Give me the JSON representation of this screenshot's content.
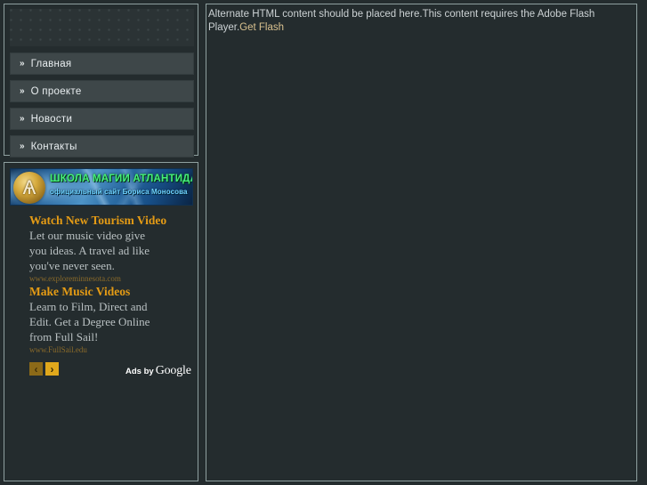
{
  "sidebar": {
    "nav": {
      "marker": "»",
      "items": [
        {
          "label": "Главная"
        },
        {
          "label": "О проекте"
        },
        {
          "label": "Новости"
        },
        {
          "label": "Контакты"
        }
      ]
    },
    "banner": {
      "title": "ШКОЛА МАГИИ АТЛАНТИДА",
      "subtitle": "официальный сайт Бориса Моносова",
      "emblem_glyph": "Ѧ",
      "title_color": "#45f07a",
      "subtitle_color": "#6fd3ff"
    },
    "ads": {
      "items": [
        {
          "title": "Watch New Tourism Video",
          "lines": [
            "Let our music video give",
            "you ideas. A travel ad like",
            "you've never seen."
          ],
          "url": "www.exploreminnesota.com"
        },
        {
          "title": "Make Music Videos",
          "lines": [
            "Learn to Film, Direct and",
            "Edit. Get a Degree Online",
            "from Full Sail!"
          ],
          "url": "www.FullSail.edu"
        }
      ],
      "prev_glyph": "‹",
      "next_glyph": "›",
      "attribution_prefix": "Ads by",
      "attribution_brand": "Google",
      "title_color": "#e49b15",
      "url_color": "#8a6a2a"
    }
  },
  "content": {
    "fallback_text": "Alternate HTML content should be placed here.This content requires the Adobe Flash Player.",
    "fallback_link": "Get Flash",
    "link_color": "#d9c18f"
  },
  "theme": {
    "page_background": "#242c2e",
    "panel_border": "#8fa0a0",
    "nav_button_background": "#3e4749",
    "nav_text_color": "#e9eef0"
  }
}
